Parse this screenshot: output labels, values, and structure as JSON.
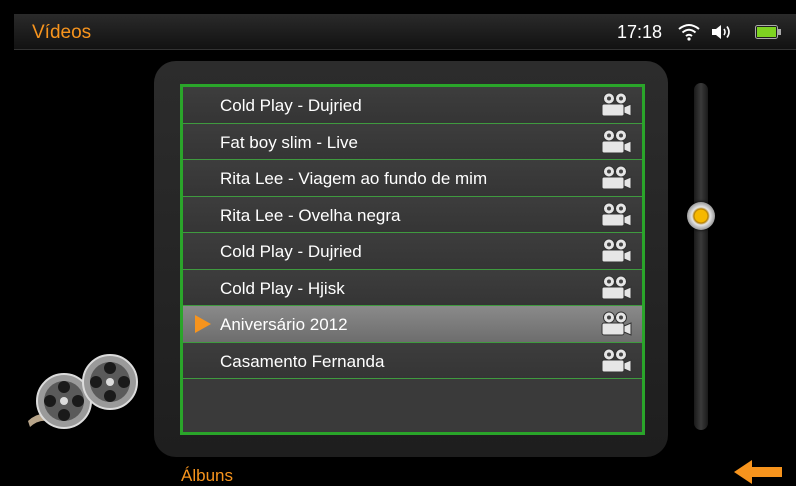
{
  "header": {
    "title": "Vídeos",
    "time": "17:18"
  },
  "icons": {
    "wifi": "wifi-icon",
    "volume": "volume-icon",
    "battery": "battery-icon",
    "row_icon": "camera-icon",
    "decor": "film-reels-icon",
    "back": "back-arrow-icon"
  },
  "videos": [
    {
      "label": "Cold Play - Dujried",
      "selected": false
    },
    {
      "label": "Fat boy slim - Live",
      "selected": false
    },
    {
      "label": "Rita Lee - Viagem ao fundo de mim",
      "selected": false
    },
    {
      "label": "Rita Lee - Ovelha negra",
      "selected": false
    },
    {
      "label": "Cold Play - Dujried",
      "selected": false
    },
    {
      "label": "Cold Play - Hjisk",
      "selected": false
    },
    {
      "label": "Aniversário 2012",
      "selected": true
    },
    {
      "label": "Casamento Fernanda",
      "selected": false
    }
  ],
  "footer": {
    "albums_label": "Álbuns"
  },
  "colors": {
    "accent": "#f7941d",
    "list_border": "#2aa52a",
    "selected_row": "#7c7c7c"
  }
}
